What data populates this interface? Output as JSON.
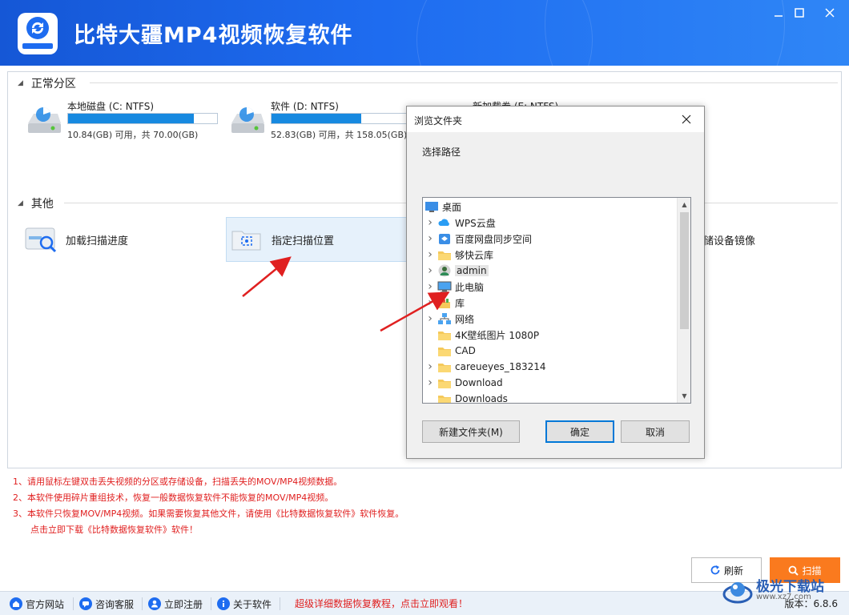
{
  "app": {
    "title": "比特大疆MP4视频恢复软件",
    "brand_color": "#1e6cf0",
    "window_controls": [
      "minimize-icon",
      "maximize-icon",
      "close-icon"
    ]
  },
  "partitions": {
    "header": "正常分区",
    "disks": [
      {
        "name": "本地磁盘 (C: NTFS)",
        "info": "10.84(GB) 可用，共 70.00(GB)",
        "used_fraction": 0.845
      },
      {
        "name": "软件 (D: NTFS)",
        "info": "52.83(GB) 可用，共 158.05(GB)",
        "used_fraction": 0.666
      },
      {
        "name": "新加载卷 (E: NTFS)",
        "info": "",
        "used_fraction": 0
      }
    ]
  },
  "others": {
    "header": "其他",
    "items": [
      {
        "label": "加载扫描进度",
        "icon": "load-progress-icon"
      },
      {
        "label": "指定扫描位置",
        "icon": "folder-scan-icon"
      },
      {
        "label": "储设备镜像",
        "icon": "device-image-icon"
      }
    ]
  },
  "notes": [
    "1、请用鼠标左键双击丢失视频的分区或存储设备，扫描丢失的MOV/MP4视频数据。",
    "2、本软件使用碎片重组技术，恢复一般数据恢复软件不能恢复的MOV/MP4视频。",
    "3、本软件只恢复MOV/MP4视频。如果需要恢复其他文件，请使用《比特数据恢复软件》软件恢复。",
    "点击立即下载《比特数据恢复软件》软件！"
  ],
  "buttons": {
    "refresh": "刷新",
    "scan": "扫描"
  },
  "statusbar": {
    "items": [
      {
        "label": "官方网站",
        "icon": "home-icon"
      },
      {
        "label": "咨询客服",
        "icon": "chat-icon"
      },
      {
        "label": "立即注册",
        "icon": "user-icon"
      },
      {
        "label": "关于软件",
        "icon": "info-icon"
      }
    ],
    "promo": "超级详细数据恢复教程，点击立即观看！",
    "version": "版本：6.8.6"
  },
  "watermark": {
    "text": "极光下载站",
    "sub": "www.xz7.com"
  },
  "dialog": {
    "title": "浏览文件夹",
    "prompt": "选择路径",
    "tree": [
      {
        "label": "桌面",
        "icon": "desktop-icon",
        "expander": false
      },
      {
        "label": "WPS云盘",
        "icon": "cloud-icon",
        "expander": true
      },
      {
        "label": "百度网盘同步空间",
        "icon": "baidu-disk-icon",
        "expander": true
      },
      {
        "label": "够快云库",
        "icon": "folder-icon",
        "expander": true
      },
      {
        "label": "admin",
        "icon": "user-folder-icon",
        "expander": true,
        "highlight": true
      },
      {
        "label": "此电脑",
        "icon": "computer-icon",
        "expander": true
      },
      {
        "label": "库",
        "icon": "library-icon",
        "expander": true
      },
      {
        "label": "网络",
        "icon": "network-icon",
        "expander": true
      },
      {
        "label": "4K壁纸图片 1080P",
        "icon": "folder-icon",
        "expander": false
      },
      {
        "label": "CAD",
        "icon": "folder-icon",
        "expander": false
      },
      {
        "label": "careueyes_183214",
        "icon": "folder-icon",
        "expander": true
      },
      {
        "label": "Download",
        "icon": "folder-icon",
        "expander": true
      },
      {
        "label": "Downloads",
        "icon": "folder-icon",
        "expander": false
      }
    ],
    "buttons": {
      "new_folder": "新建文件夹(M)",
      "ok": "确定",
      "cancel": "取消"
    }
  }
}
